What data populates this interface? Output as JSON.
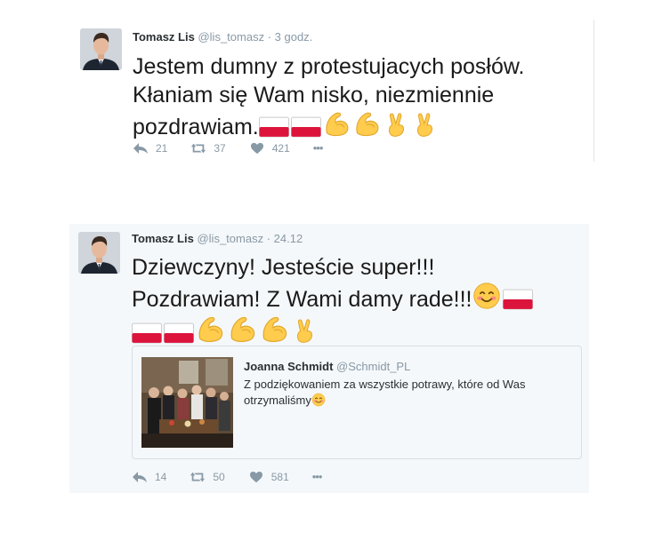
{
  "tweets": [
    {
      "author_name": "Tomasz Lis",
      "handle": "@lis_tomasz",
      "time": "· 3 godz.",
      "text_lines": [
        "Jestem dumny z protestujacych posłów.",
        "Kłaniam się Wam nisko, niezmiennie",
        "pozdrawiam."
      ],
      "emojis": [
        "flag-poland",
        "flag-poland",
        "flexed-biceps",
        "flexed-biceps",
        "victory-hand",
        "victory-hand"
      ],
      "replies": "21",
      "retweets": "37",
      "likes": "421",
      "more": "•••"
    },
    {
      "author_name": "Tomasz Lis",
      "handle": "@lis_tomasz",
      "time": "· 24.12",
      "text_lines": [
        "Dziewczyny! Jesteście super!!!",
        "Pozdrawiam! Z Wami damy rade!!!"
      ],
      "emojis": [
        "smiling-face",
        "flag-poland",
        "flag-poland",
        "flag-poland",
        "flexed-biceps",
        "flexed-biceps",
        "flexed-biceps",
        "victory-hand"
      ],
      "replies": "14",
      "retweets": "50",
      "likes": "581",
      "more": "•••",
      "quoted": {
        "author_name": "Joanna Schmidt",
        "handle": "@Schmidt_PL",
        "text_lines": [
          "Z podziękowaniem za wszystkie potrawy, które od Was",
          "otrzymaliśmy"
        ],
        "emojis": [
          "smiling-face"
        ]
      }
    }
  ],
  "colors": {
    "muted": "#8899a6",
    "quote_bg": "#f5f8fa",
    "flag_red": "#dc143c",
    "emoji_yellow": "#ffcc4d"
  }
}
